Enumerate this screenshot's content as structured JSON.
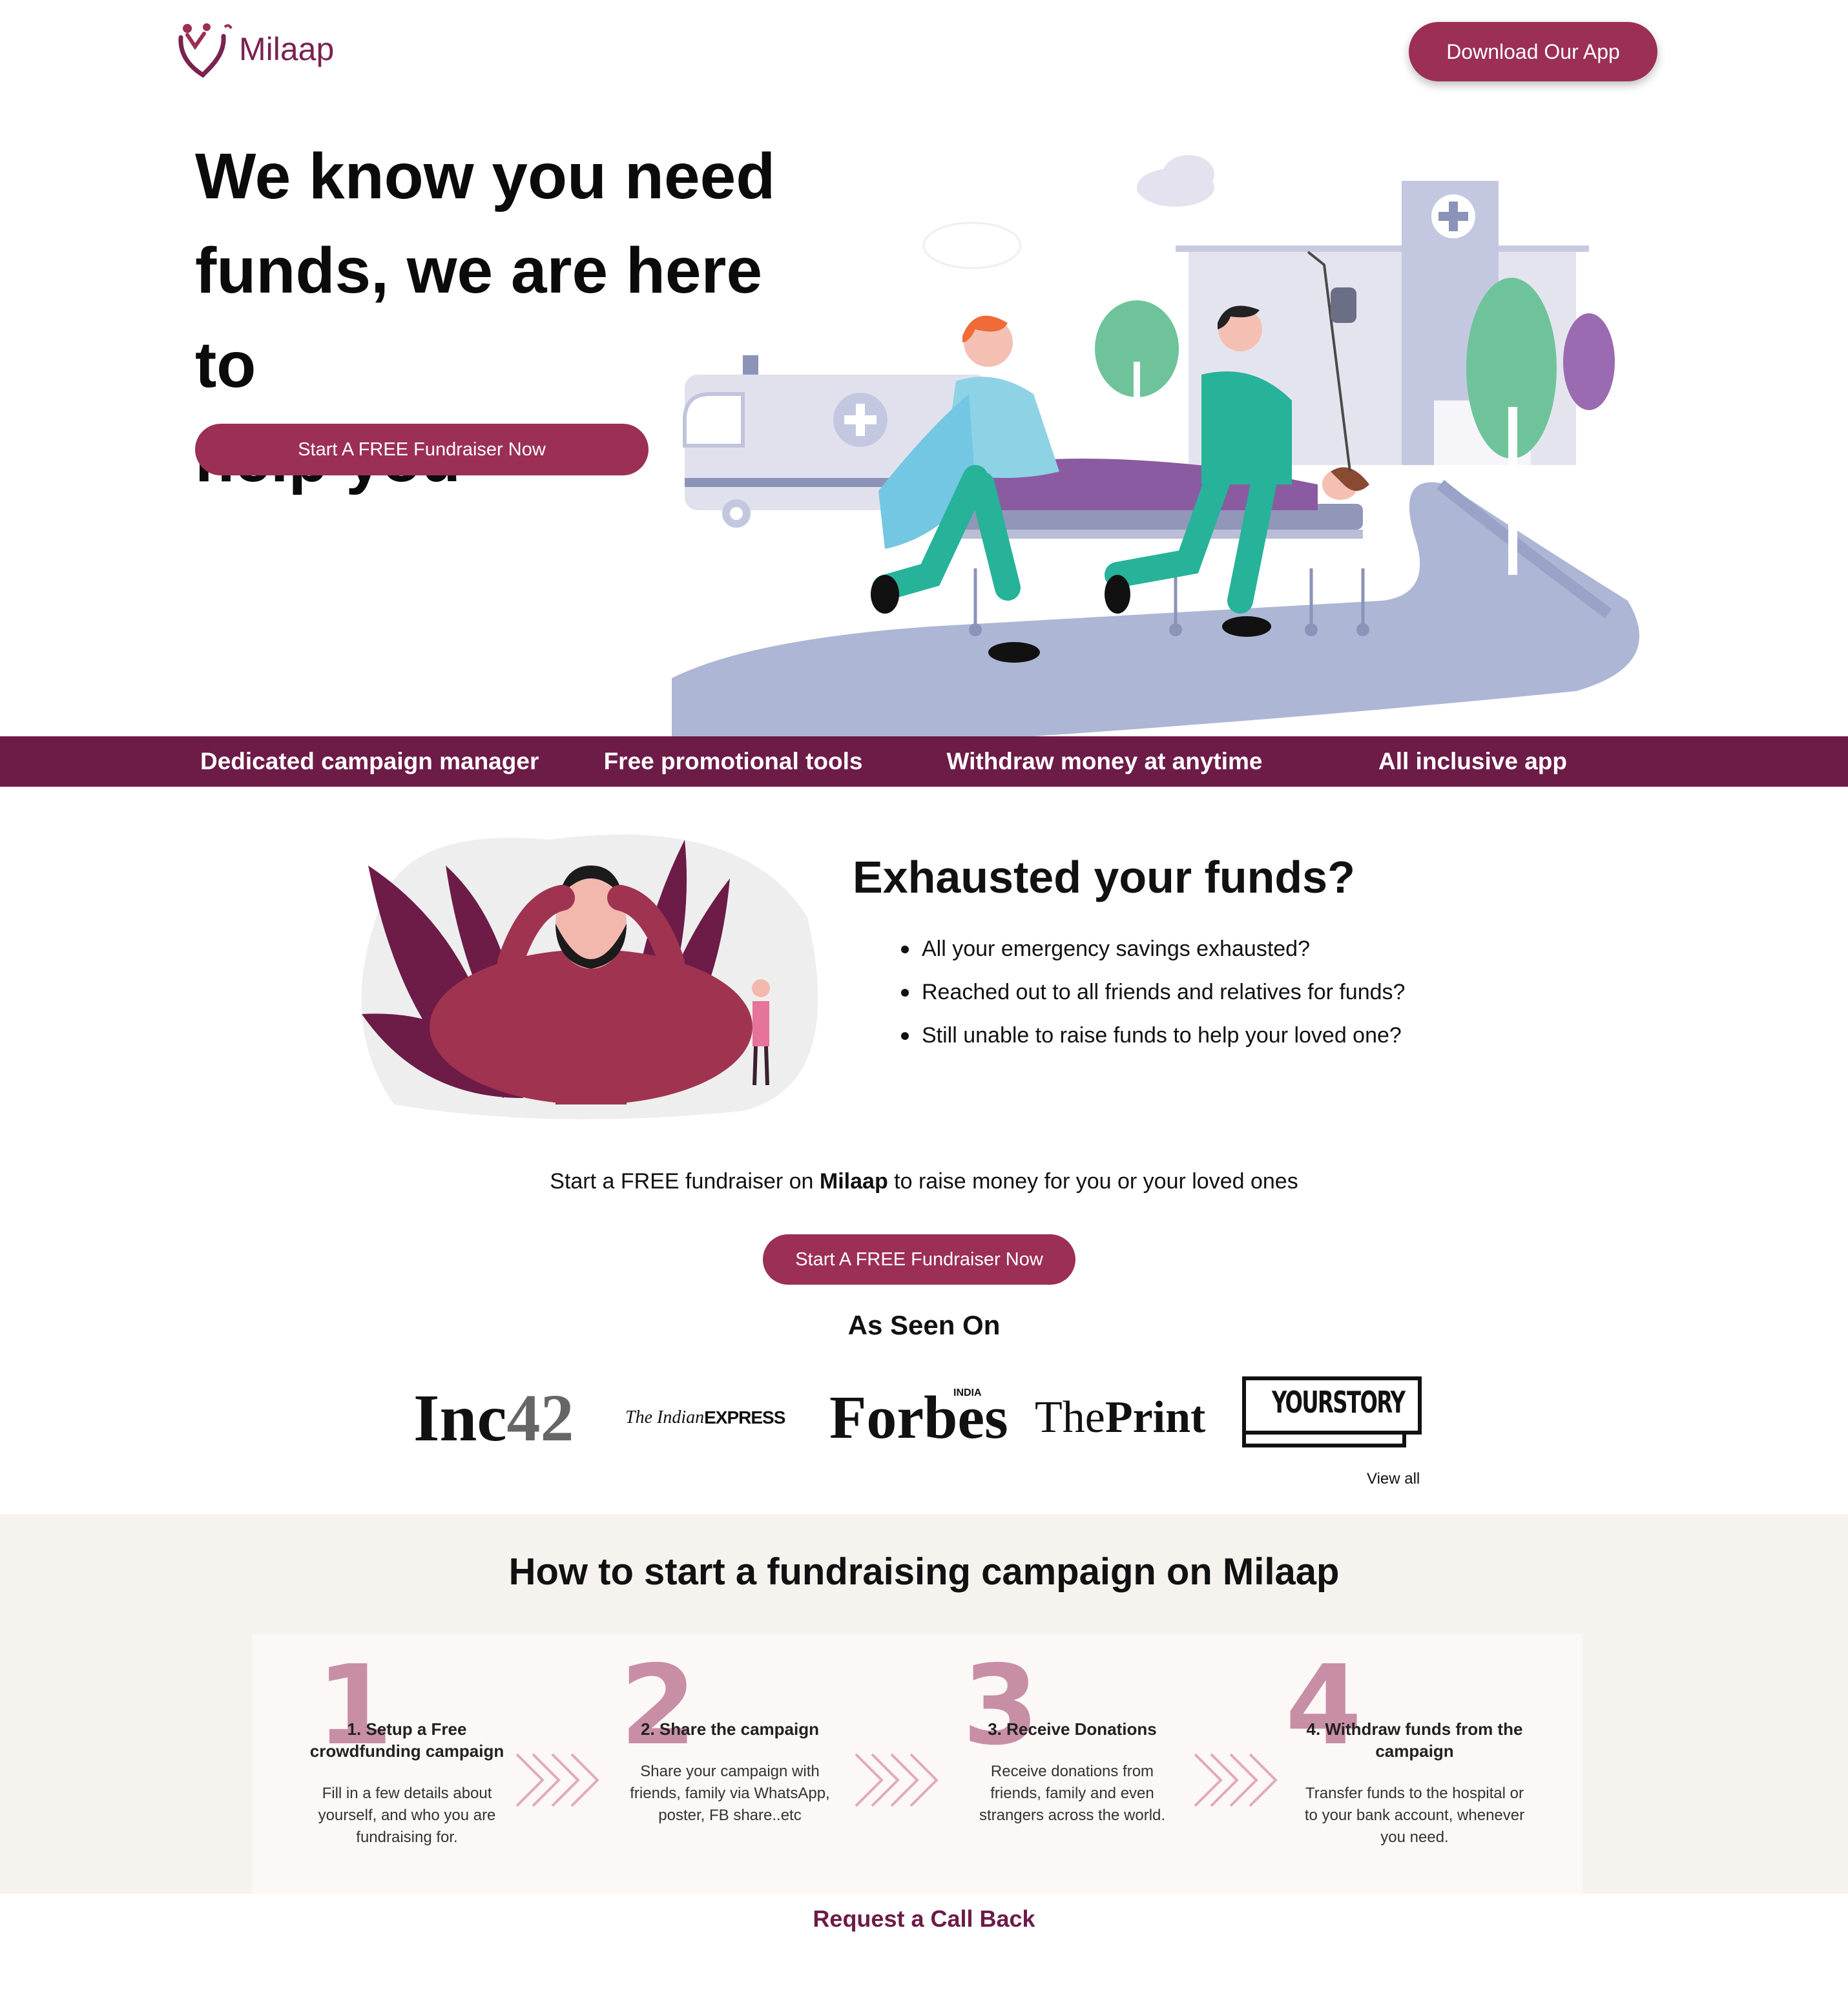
{
  "header": {
    "logo_text": "Milaap",
    "download_label": "Download Our App"
  },
  "hero": {
    "title_line1": "We know you need",
    "title_line2": "funds, we are here to",
    "title_line3": "help you",
    "cta_label": "Start A FREE Fundraiser Now"
  },
  "features": [
    "Dedicated campaign manager",
    "Free promotional tools",
    "Withdraw money at anytime",
    "All inclusive app"
  ],
  "exhausted": {
    "title": "Exhausted your funds?",
    "bullets": [
      "All your emergency savings exhausted?",
      "Reached out to all friends and relatives for funds?",
      "Still unable to raise funds to help your loved one?"
    ]
  },
  "subline": {
    "before": "Start a FREE fundraiser on ",
    "brand": "Milaap",
    "after": " to raise money for you or your loved ones"
  },
  "mid_cta_label": "Start A FREE Fundraiser Now",
  "seen_on": {
    "title": "As Seen On",
    "logos": {
      "inc42_a": "Inc",
      "inc42_b": "42",
      "ie_a": "The Indian ",
      "ie_b": "EXPRESS",
      "forbes": "Forbes",
      "forbes_badge": "INDIA",
      "print_a": "The",
      "print_b": "Print",
      "yourstory": "YOURSTORY"
    },
    "view_all": "View all"
  },
  "how": {
    "title": "How to start a fundraising campaign on Milaap",
    "steps": [
      {
        "num": "1",
        "title": "1. Setup a Free crowdfunding campaign",
        "desc": "Fill in a few details about yourself, and who you are fundraising for."
      },
      {
        "num": "2",
        "title": "2. Share the campaign",
        "desc": "Share your campaign with friends, family via WhatsApp, poster, FB share..etc"
      },
      {
        "num": "3",
        "title": "3. Receive Donations",
        "desc": "Receive donations from friends, family and even strangers across the world."
      },
      {
        "num": "4",
        "title": "4. Withdraw funds from the campaign",
        "desc": "Transfer funds to the hospital or to your bank account, whenever you need."
      }
    ]
  },
  "callback_label": "Request a Call Back",
  "colors": {
    "brand": "#9c2f55",
    "feature_bar": "#6d1b47",
    "step_number": "#c88ea6",
    "section_bg": "#f6f3ef"
  }
}
